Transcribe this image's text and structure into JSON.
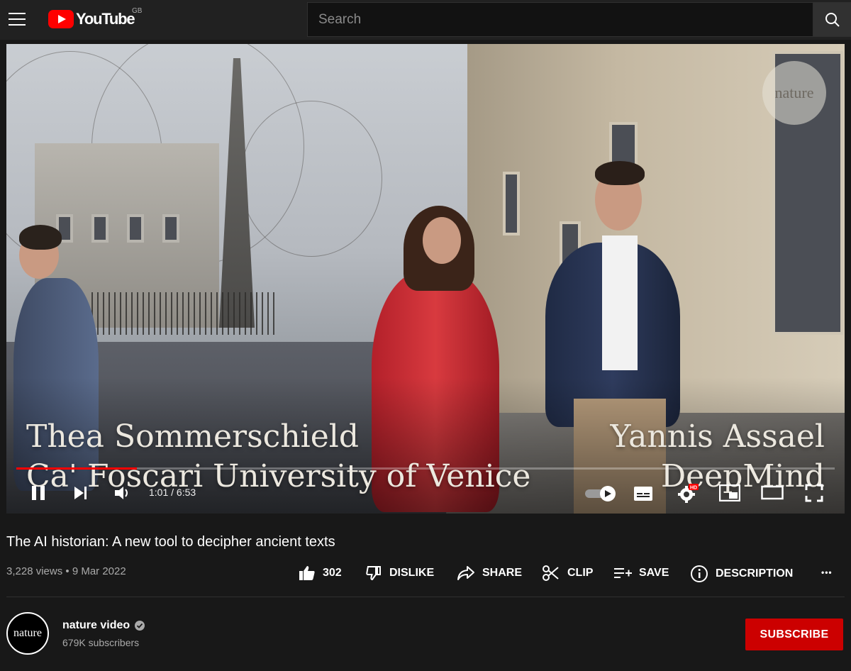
{
  "header": {
    "logo_text": "YouTube",
    "region": "GB",
    "search_placeholder": "Search"
  },
  "player": {
    "lower_third": {
      "left_name": "Thea Sommerschield",
      "left_affiliation": "Ca' Foscari University of Venice",
      "right_name": "Yannis Assael",
      "right_affiliation": "DeepMind"
    },
    "watermark": "nature",
    "time_display": "1:01 / 6:53",
    "progress_fraction": 0.147,
    "hd_badge": "HD",
    "autoplay_on": true
  },
  "video": {
    "title": "The AI historian: A new tool to decipher ancient texts",
    "views": "3,228 views",
    "date": "9 Mar 2022",
    "meta_sep": " • "
  },
  "actions": {
    "like_count": "302",
    "dislike": "DISLIKE",
    "share": "SHARE",
    "clip": "CLIP",
    "save": "SAVE",
    "description": "DESCRIPTION",
    "more": "•••"
  },
  "channel": {
    "avatar_text": "nature",
    "name": "nature video",
    "verified": true,
    "subscribers": "679K subscribers",
    "subscribe_label": "SUBSCRIBE"
  },
  "colors": {
    "accent": "#ff0000",
    "subscribe": "#cc0000",
    "background": "#181818",
    "header": "#212121"
  }
}
